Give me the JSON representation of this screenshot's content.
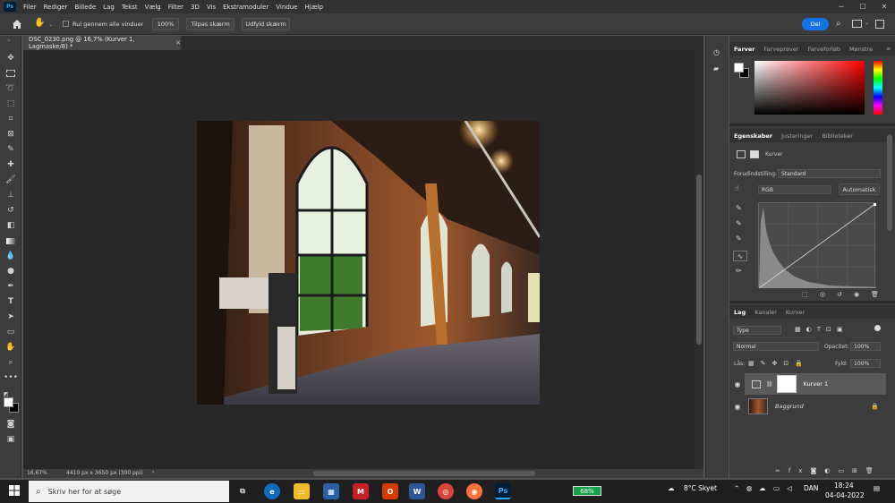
{
  "menubar": {
    "logo": "Ps",
    "items": [
      "Filer",
      "Rediger",
      "Billede",
      "Lag",
      "Tekst",
      "Vælg",
      "Filter",
      "3D",
      "Vis",
      "Ekstramoduler",
      "Vindue",
      "Hjælp"
    ],
    "minimize": "─",
    "maximize": "☐",
    "close": "✕"
  },
  "options": {
    "scroll_all_label": "Rul gennem alle vinduer",
    "zoom_100": "100%",
    "fit_screen": "Tilpas skærm",
    "fill_screen": "Udfyld skærm",
    "share_label": "Del"
  },
  "document": {
    "tab_title": "DSC_0230.png @ 16,7% (Kurver 1, Lagmaske/8) *",
    "close": "✕",
    "zoom": "16,67%",
    "dimensions": "4410 px x 3650 px (300 ppi)"
  },
  "color_panel": {
    "tabs": [
      "Farver",
      "Farveprøver",
      "Farveforløb",
      "Mønstre"
    ]
  },
  "properties_panel": {
    "tabs": [
      "Egenskaber",
      "Justeringer",
      "Biblioteker"
    ],
    "type_label": "Kurver",
    "preset_label": "Forudindstilling:",
    "preset_value": "Standard",
    "channel_value": "RGB",
    "auto_label": "Automatisk"
  },
  "layers_panel": {
    "tabs": [
      "Lag",
      "Kanaler",
      "Kurver"
    ],
    "filter_value": "Type",
    "blend_mode": "Normal",
    "opacity_label": "Opacitet:",
    "opacity_value": "100%",
    "lock_label": "Lås:",
    "fill_label": "Fyld:",
    "fill_value": "100%",
    "layers": [
      {
        "name": "Kurver 1",
        "selected": true
      },
      {
        "name": "Baggrund",
        "selected": false
      }
    ]
  },
  "taskbar": {
    "search_placeholder": "Skriv her for at søge",
    "battery": "68%",
    "weather": "8°C  Skyet",
    "language": "DAN",
    "time": "18:24",
    "date": "04-04-2022"
  },
  "colors": {
    "accent": "#1473e6",
    "panel_bg": "#3c3c3c",
    "canvas_bg": "#282828"
  }
}
